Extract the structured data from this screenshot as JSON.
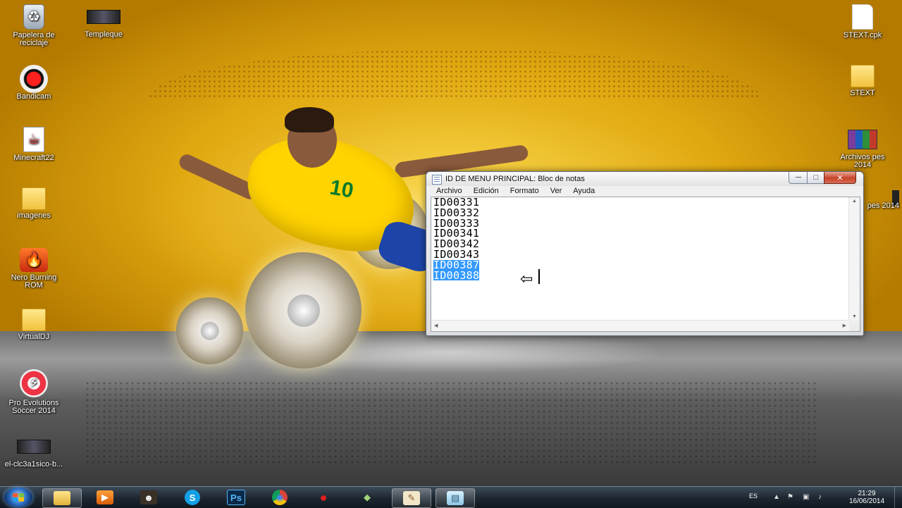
{
  "desktop": {
    "left_icons": [
      {
        "label": "Papelera de reciclaje",
        "icon": "recycle-bin-icon"
      },
      {
        "label": "Templeque",
        "icon": "video-thumbnail-icon"
      },
      {
        "label": "Bandicam",
        "icon": "bandicam-icon"
      },
      {
        "label": "Minecraft22",
        "icon": "java-file-icon"
      },
      {
        "label": "imagenes",
        "icon": "folder-icon"
      },
      {
        "label": "Nero Burning ROM",
        "icon": "nero-icon"
      },
      {
        "label": "VirtualDJ",
        "icon": "folder-icon"
      },
      {
        "label": "Pro Evolutions Soccer 2014",
        "icon": "pes-icon"
      },
      {
        "label": "el-clc3a1sico-b...",
        "icon": "video-thumbnail-icon"
      }
    ],
    "right_icons": [
      {
        "label": "STEXT.cpk",
        "icon": "file-icon"
      },
      {
        "label": "STEXT",
        "icon": "folder-icon"
      },
      {
        "label": "Archivos pes 2014",
        "icon": "winrar-icon"
      },
      {
        "label": "pes 2014",
        "icon": "partially-hidden-icon"
      }
    ],
    "wallpaper_shirt_number": "10"
  },
  "notepad": {
    "title": "ID DE MENU PRINCIPAL: Bloc de notas",
    "controls": {
      "minimize": "─",
      "maximize": "□",
      "close": "✕"
    },
    "menu": [
      "Archivo",
      "Edición",
      "Formato",
      "Ver",
      "Ayuda"
    ],
    "lines": [
      {
        "text": "ID00331",
        "selected": false
      },
      {
        "text": "ID00332",
        "selected": false
      },
      {
        "text": "ID00333",
        "selected": false
      },
      {
        "text": "ID00341",
        "selected": false
      },
      {
        "text": "ID00342",
        "selected": false
      },
      {
        "text": "ID00343",
        "selected": false
      },
      {
        "text": "ID00387",
        "selected": true
      },
      {
        "text": "ID00388",
        "selected": true
      }
    ],
    "selection_color": "#3399ff"
  },
  "taskbar": {
    "start_icon": "windows-start-icon",
    "pinned": [
      {
        "name": "explorer",
        "glyph": "📁",
        "open": true
      },
      {
        "name": "media-player",
        "glyph": "▶",
        "open": false
      },
      {
        "name": "game",
        "glyph": "☻",
        "open": false
      },
      {
        "name": "skype",
        "glyph": "S",
        "open": false
      },
      {
        "name": "photoshop",
        "glyph": "Ps",
        "open": false
      },
      {
        "name": "chrome",
        "glyph": "◉",
        "open": false
      },
      {
        "name": "bandicam",
        "glyph": "●",
        "open": false
      },
      {
        "name": "tool",
        "glyph": "◆",
        "open": false
      },
      {
        "name": "notepad-pen",
        "glyph": "✎",
        "open": true
      },
      {
        "name": "notepad",
        "glyph": "▤",
        "open": true
      }
    ],
    "tray": {
      "language": "ES",
      "time": "21:29",
      "date": "16/06/2014"
    }
  }
}
